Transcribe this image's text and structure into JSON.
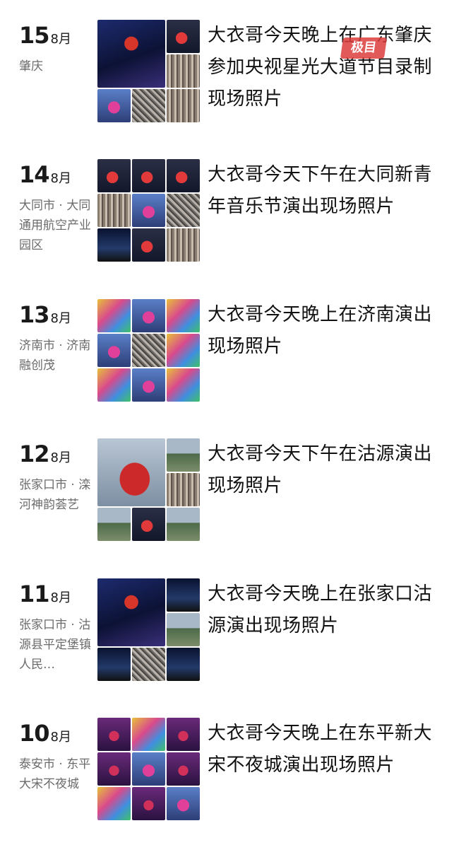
{
  "posts": [
    {
      "day": "15",
      "month": "8月",
      "location": "肇庆",
      "title": "大衣哥今天晚上在广东肇庆参加央视星光大道节目录制现场照片"
    },
    {
      "day": "14",
      "month": "8月",
      "location": "大同市 · 大同通用航空产业园区",
      "title": "大衣哥今天下午在大同新青年音乐节演出现场照片"
    },
    {
      "day": "13",
      "month": "8月",
      "location": "济南市 · 济南融创茂",
      "title": "大衣哥今天晚上在济南演出现场照片"
    },
    {
      "day": "12",
      "month": "8月",
      "location": "张家口市 · 滦河神韵荟艺",
      "title": "大衣哥今天下午在沽源演出现场照片"
    },
    {
      "day": "11",
      "month": "8月",
      "location": "张家口市 · 沽源县平定堡镇人民…",
      "title": "大衣哥今天晚上在张家口沽源演出现场照片"
    },
    {
      "day": "10",
      "month": "8月",
      "location": "泰安市 · 东平大宋不夜城",
      "title": "大衣哥今天晚上在东平新大宋不夜城演出现场照片"
    }
  ],
  "watermark": "极目"
}
